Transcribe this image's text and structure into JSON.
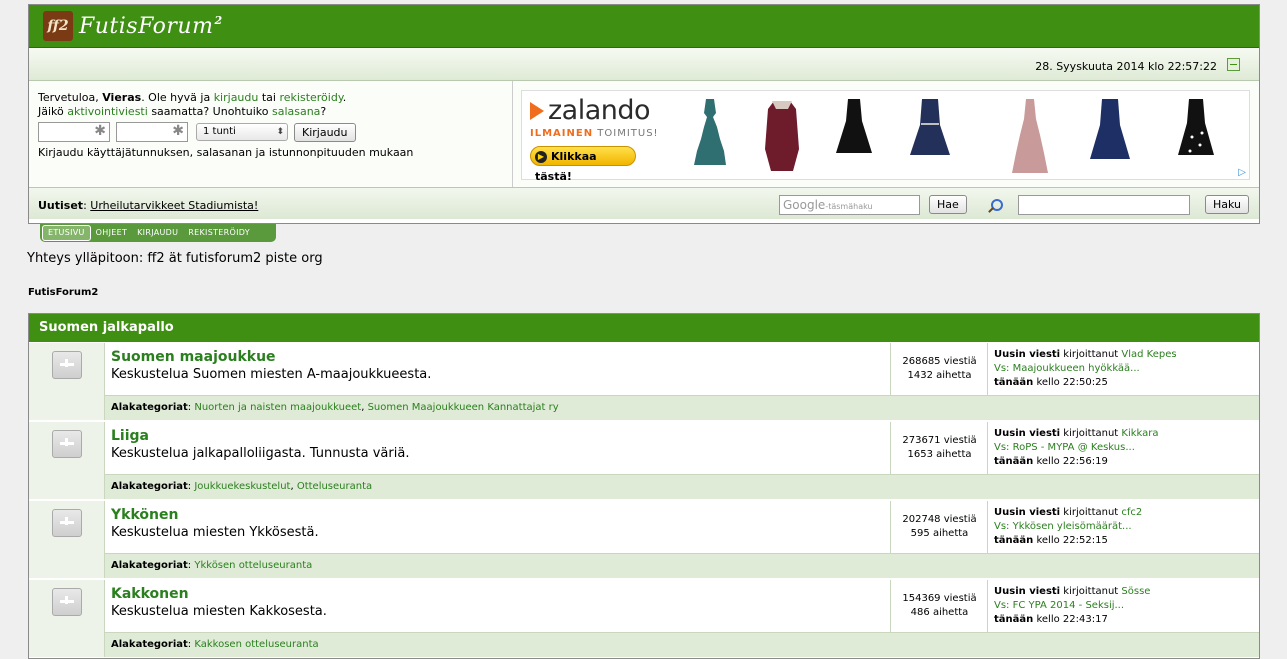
{
  "header": {
    "logo_badge": "ff2",
    "logo_text": "FutisForum",
    "logo_sup": "2",
    "datetime": "28. Syyskuuta 2014 klo 22:57:22"
  },
  "login": {
    "welcome": "Tervetuloa,",
    "guest": "Vieras",
    "please": ". Ole hyvä ja",
    "login_link": "kirjaudu",
    "or": "tai",
    "register_link": "rekisteröidy",
    "end": ".",
    "missed": "Jäikö",
    "activation_link": "aktivointiviesti",
    "missed2": "saamatta? Unohtuiko",
    "password_link": "salasana",
    "q": "?",
    "duration": "1 tunti",
    "login_button": "Kirjaudu",
    "hint": "Kirjaudu käyttäjätunnuksen, salasanan ja istunnonpituuden mukaan"
  },
  "ad": {
    "brand": "zalando",
    "free": "ILMAINEN",
    "delivery": "TOIMITUS!",
    "cta": "Klikkaa tästä!"
  },
  "newsbar": {
    "label": "Uutiset",
    "news_link": "Urheilutarvikkeet Stadiumista!",
    "google": "Google",
    "google_hint": "-täsmähaku",
    "search_button": "Hae",
    "haku_button": "Haku"
  },
  "tabs": [
    "ETUSIVU",
    "OHJEET",
    "KIRJAUDU",
    "REKISTERÖIDY"
  ],
  "contact": "Yhteys ylläpitoon: ff2 ät futisforum2 piste org",
  "forum_name": "FutisForum2",
  "category": {
    "title": "Suomen jalkapallo",
    "boards": [
      {
        "title": "Suomen maajoukkue",
        "desc": "Keskustelua Suomen miesten A-maajoukkueesta.",
        "posts": "268685 viestiä",
        "topics": "1432 aihetta",
        "last_label": "Uusin viesti",
        "by": "kirjoittanut",
        "user": "Vlad Kepes",
        "topic": "Vs: Maajoukkueen hyökkää...",
        "when": "tänään",
        "time": "kello 22:50:25",
        "sub_label": "Alakategoriat",
        "subs": [
          "Nuorten ja naisten maajoukkueet",
          "Suomen Maajoukkueen Kannattajat ry"
        ]
      },
      {
        "title": "Liiga",
        "desc": "Keskustelua jalkapalloliigasta. Tunnusta väriä.",
        "posts": "273671 viestiä",
        "topics": "1653 aihetta",
        "last_label": "Uusin viesti",
        "by": "kirjoittanut",
        "user": "Kikkara",
        "topic": "Vs: RoPS - MYPA @ Keskus...",
        "when": "tänään",
        "time": "kello 22:56:19",
        "sub_label": "Alakategoriat",
        "subs": [
          "Joukkuekeskustelut",
          "Otteluseuranta"
        ]
      },
      {
        "title": "Ykkönen",
        "desc": "Keskustelua miesten Ykkösestä.",
        "posts": "202748 viestiä",
        "topics": "595 aihetta",
        "last_label": "Uusin viesti",
        "by": "kirjoittanut",
        "user": "cfc2",
        "topic": "Vs: Ykkösen yleisömäärät...",
        "when": "tänään",
        "time": "kello 22:52:15",
        "sub_label": "Alakategoriat",
        "subs": [
          "Ykkösen otteluseuranta"
        ]
      },
      {
        "title": "Kakkonen",
        "desc": "Keskustelua miesten Kakkosesta.",
        "posts": "154369 viestiä",
        "topics": "486 aihetta",
        "last_label": "Uusin viesti",
        "by": "kirjoittanut",
        "user": "Sösse",
        "topic": "Vs: FC YPA 2014 - Seksij...",
        "when": "tänään",
        "time": "kello 22:43:17",
        "sub_label": "Alakategoriat",
        "subs": [
          "Kakkosen otteluseuranta"
        ]
      }
    ]
  }
}
